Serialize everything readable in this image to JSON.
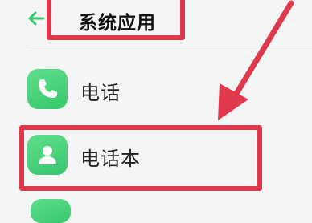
{
  "header": {
    "title": "系统应用",
    "back_icon": "arrow-left-icon"
  },
  "items": [
    {
      "label": "电话",
      "icon": "phone-icon"
    },
    {
      "label": "电话本",
      "icon": "contact-person-icon"
    }
  ],
  "colors": {
    "accent": "#3cc870",
    "highlight": "#e0394b"
  }
}
